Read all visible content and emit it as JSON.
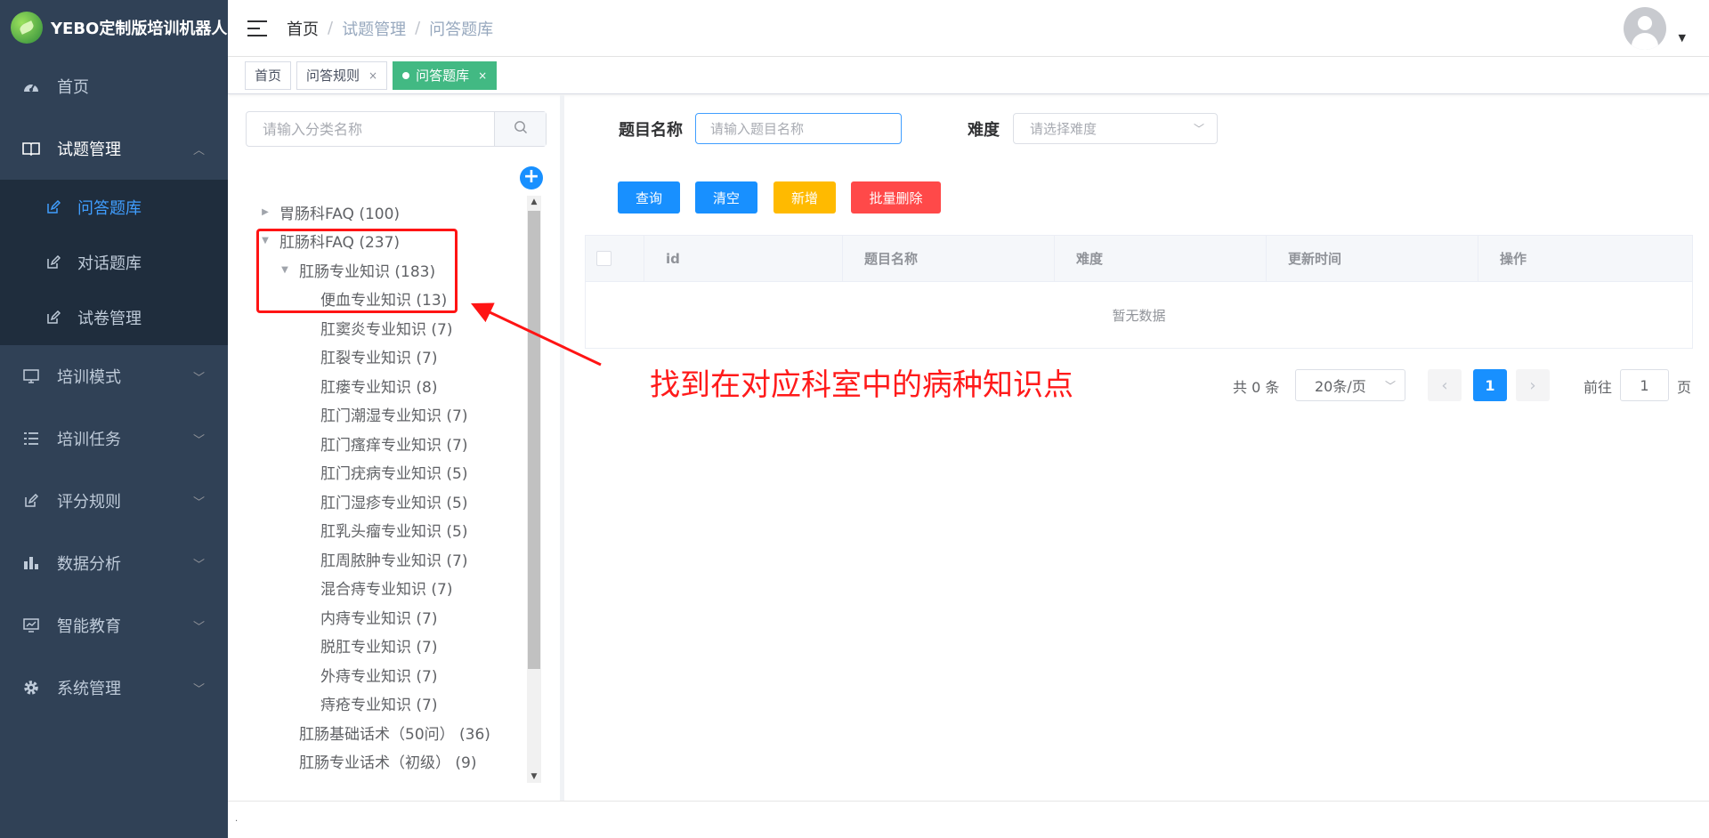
{
  "app": {
    "title": "YEBO定制版培训机器人"
  },
  "sidebar": {
    "home": "首页",
    "exam_mgmt": {
      "label": "试题管理",
      "children": [
        "问答题库",
        "对话题库",
        "试卷管理"
      ]
    },
    "menus": [
      "培训模式",
      "培训任务",
      "评分规则",
      "数据分析",
      "智能教育",
      "系统管理"
    ]
  },
  "breadcrumb": [
    "首页",
    "试题管理",
    "问答题库"
  ],
  "tags": [
    {
      "label": "首页"
    },
    {
      "label": "问答规则"
    },
    {
      "label": "问答题库",
      "active": true
    }
  ],
  "tree": {
    "search_placeholder": "请输入分类名称",
    "nodes": [
      {
        "label": "胃肠科FAQ (100)",
        "level": 0,
        "expanded": false
      },
      {
        "label": "肛肠科FAQ (237)",
        "level": 0,
        "expanded": true
      },
      {
        "label": "肛肠专业知识 (183)",
        "level": 1,
        "expanded": true
      },
      {
        "label": "便血专业知识 (13)",
        "level": 2
      },
      {
        "label": "肛窦炎专业知识 (7)",
        "level": 2
      },
      {
        "label": "肛裂专业知识 (7)",
        "level": 2
      },
      {
        "label": "肛瘘专业知识 (8)",
        "level": 2
      },
      {
        "label": "肛门潮湿专业知识 (7)",
        "level": 2
      },
      {
        "label": "肛门瘙痒专业知识 (7)",
        "level": 2
      },
      {
        "label": "肛门疣病专业知识 (5)",
        "level": 2
      },
      {
        "label": "肛门湿疹专业知识 (5)",
        "level": 2
      },
      {
        "label": "肛乳头瘤专业知识 (5)",
        "level": 2
      },
      {
        "label": "肛周脓肿专业知识 (7)",
        "level": 2
      },
      {
        "label": "混合痔专业知识 (7)",
        "level": 2
      },
      {
        "label": "内痔专业知识 (7)",
        "level": 2
      },
      {
        "label": "脱肛专业知识 (7)",
        "level": 2
      },
      {
        "label": "外痔专业知识 (7)",
        "level": 2
      },
      {
        "label": "痔疮专业知识 (7)",
        "level": 2
      },
      {
        "label": "肛肠基础话术（50问） (36)",
        "level": 1
      },
      {
        "label": "肛肠专业话术（初级） (9)",
        "level": 1
      }
    ]
  },
  "filters": {
    "name_label": "题目名称",
    "name_placeholder": "请输入题目名称",
    "difficulty_label": "难度",
    "difficulty_placeholder": "请选择难度"
  },
  "buttons": {
    "query": "查询",
    "clear": "清空",
    "add": "新增",
    "batch_delete": "批量删除"
  },
  "table": {
    "columns": [
      "id",
      "题目名称",
      "难度",
      "更新时间",
      "操作"
    ],
    "empty_text": "暂无数据"
  },
  "pagination": {
    "total": "共 0 条",
    "page_size": "20条/页",
    "current_page": "1",
    "goto_label": "前往",
    "goto_value": "1",
    "page_suffix": "页"
  },
  "footer": {
    "text": "."
  },
  "annotation": {
    "text": "找到在对应科室中的病种知识点",
    "color": "#ff1a1a"
  },
  "colors": {
    "sidebar_bg": "#304156",
    "primary": "#1890ff",
    "tag_active": "#42b983",
    "warning": "#ffba00",
    "danger": "#ff4949"
  }
}
